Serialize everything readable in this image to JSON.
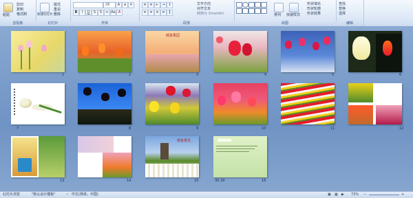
{
  "ribbon": {
    "groups": [
      "剪贴板",
      "幻灯片",
      "字体",
      "段落",
      "绘图",
      "编辑"
    ],
    "clipboard": {
      "paste": "粘贴",
      "cut": "剪切",
      "copy": "复制",
      "format_painter": "格式刷"
    },
    "slides": {
      "new_slide": "新建幻灯片",
      "layout": "版式",
      "reset": "重设",
      "delete": "删除"
    },
    "font": {
      "font_name": "",
      "font_size": "28"
    },
    "paragraph": {
      "text_direction": "文字方向",
      "align_text": "对齐文本",
      "smartart": "转换为 SmartArt"
    },
    "drawing": {
      "arrange": "排列",
      "quick_styles": "快速样式",
      "shape_fill": "形状填充",
      "shape_outline": "形状轮廓",
      "shape_effects": "形状效果"
    },
    "editing": {
      "find": "查找",
      "replace": "替换",
      "select": "选择"
    }
  },
  "slides": [
    {
      "n": "1"
    },
    {
      "n": "2"
    },
    {
      "n": "3"
    },
    {
      "n": "4"
    },
    {
      "n": "5"
    },
    {
      "n": "6"
    },
    {
      "n": "7"
    },
    {
      "n": "8"
    },
    {
      "n": "9"
    },
    {
      "n": "10"
    },
    {
      "n": "11"
    },
    {
      "n": "12"
    },
    {
      "n": "13"
    },
    {
      "n": "14"
    },
    {
      "n": "15"
    },
    {
      "n": "16"
    }
  ],
  "slide_text": {
    "s3_title": "郁金香园",
    "s15_title": "郁金香花",
    "s16_label": "30 29"
  },
  "status": {
    "view": "幻灯片浏览",
    "theme": "\"默认设计模板\"",
    "language": "中文(简体，中国)",
    "zoom": "73%"
  }
}
